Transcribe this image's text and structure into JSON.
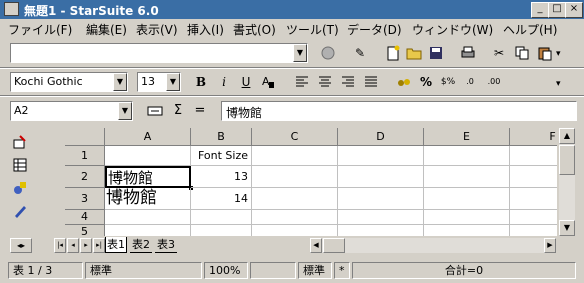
{
  "window": {
    "title": "無題1 - StarSuite 6.0"
  },
  "menu": [
    "ファイル(F)",
    "編集(E)",
    "表示(V)",
    "挿入(I)",
    "書式(O)",
    "ツール(T)",
    "データ(D)",
    "ウィンドウ(W)",
    "ヘルプ(H)"
  ],
  "toolbar": {
    "url_value": ""
  },
  "format": {
    "font_name": "Kochi Gothic",
    "font_size": "13",
    "bold": "B",
    "italic": "i",
    "underline": "U"
  },
  "formula": {
    "cell_ref": "A2",
    "sum_glyph": "Σ",
    "equals_glyph": "=",
    "content": "博物館"
  },
  "sheet": {
    "columns": [
      "A",
      "B",
      "C",
      "D",
      "E",
      "F"
    ],
    "rows": [
      "1",
      "2",
      "3",
      "4",
      "5"
    ],
    "cells": {
      "B1": "Font Size",
      "A2": "博物館",
      "B2": "13",
      "A3": "博物館",
      "B3": "14"
    },
    "tabs": [
      "表1",
      "表2",
      "表3"
    ]
  },
  "status": {
    "sheet": "表 1 / 3",
    "style": "標準",
    "zoom": "100%",
    "mode": "標準",
    "ins": "*",
    "sum": "合計=0"
  }
}
